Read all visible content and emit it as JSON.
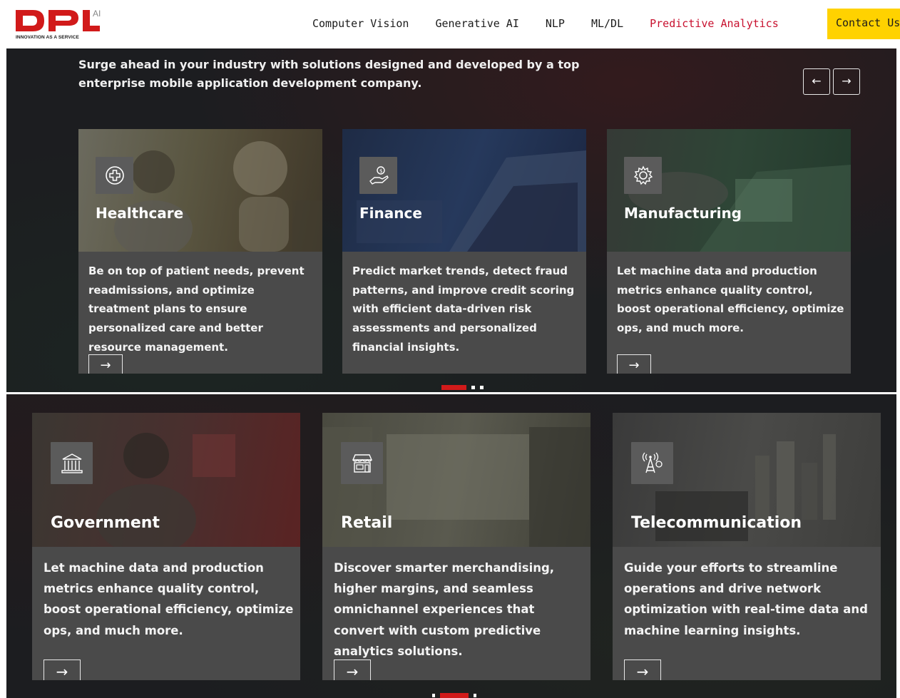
{
  "brand": {
    "ai_suffix": "AI",
    "tagline": "INNOVATION AS A SERVICE",
    "color_red": "#d11a1a",
    "color_yellow": "#ffd200"
  },
  "nav": {
    "items": [
      {
        "label": "Computer Vision",
        "active": false
      },
      {
        "label": "Generative AI",
        "active": false
      },
      {
        "label": "NLP",
        "active": false
      },
      {
        "label": "ML/DL",
        "active": false
      },
      {
        "label": "Predictive Analytics",
        "active": true
      }
    ],
    "contact_label": "Contact Us"
  },
  "top_section": {
    "intro": "Surge ahead in your industry with solutions designed and developed by a top enterprise mobile application development company.",
    "prev_icon": "←",
    "next_icon": "→",
    "cards": [
      {
        "title": "Healthcare",
        "icon": "medical-cross-icon",
        "body": "Be on top of patient needs, prevent readmissions, and optimize treatment plans to ensure personalized care and better resource management.",
        "arrow": "→"
      },
      {
        "title": "Finance",
        "icon": "money-hand-icon",
        "body": "Predict market trends, detect fraud patterns, and improve credit scoring with efficient data-driven risk assessments and personalized financial insights.",
        "arrow": "→"
      },
      {
        "title": "Manufacturing",
        "icon": "gear-icon",
        "body": "Let machine data and production metrics enhance quality control, boost operational efficiency, optimize ops, and much more.",
        "arrow": "→"
      }
    ]
  },
  "bottom_section": {
    "cards": [
      {
        "title": "Government",
        "icon": "government-building-icon",
        "body": "Let machine data and production metrics enhance quality control, boost operational efficiency, optimize ops, and much more.",
        "arrow": "→"
      },
      {
        "title": "Retail",
        "icon": "store-icon",
        "body": "Discover smarter merchandising, higher margins, and seamless omnichannel experiences that convert with custom predictive analytics solutions.",
        "arrow": "→"
      },
      {
        "title": "Telecommunication",
        "icon": "signal-tower-icon",
        "body": "Guide your efforts to streamline operations and drive network optimization with real-time data and machine learning insights.",
        "arrow": "→"
      }
    ]
  }
}
